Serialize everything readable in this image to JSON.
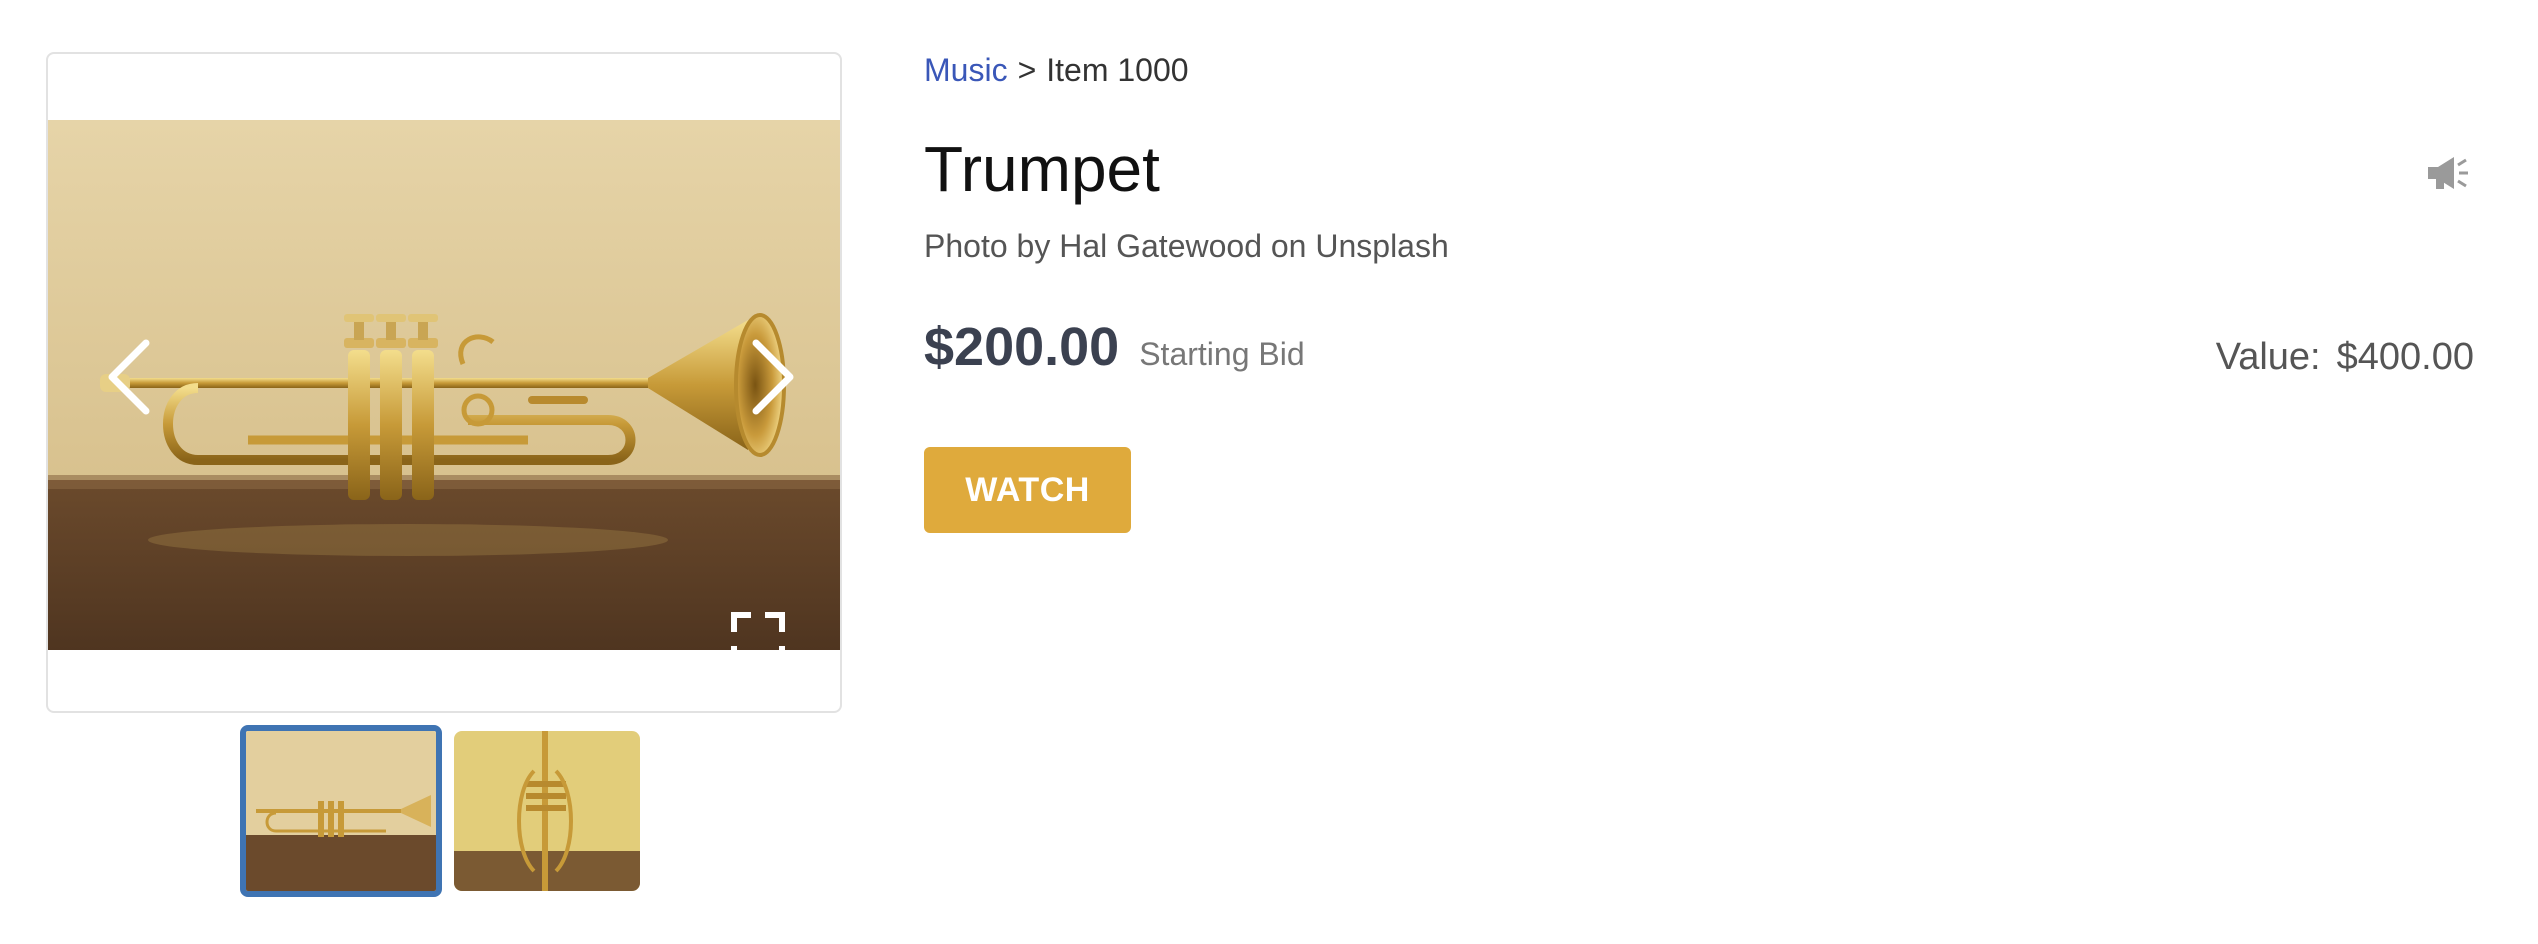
{
  "breadcrumb": {
    "category": "Music",
    "separator": ">",
    "item": "Item 1000"
  },
  "item": {
    "title": "Trumpet",
    "photo_credit": "Photo by Hal Gatewood on Unsplash",
    "price": "$200.00",
    "price_caption": "Starting Bid",
    "value_label": "Value:",
    "value_amount": "$400.00"
  },
  "actions": {
    "watch_label": "WATCH"
  },
  "gallery": {
    "thumbnail_count": 2,
    "active_thumbnail": 1
  },
  "icons": {
    "prev": "chevron-left-icon",
    "next": "chevron-right-icon",
    "fullscreen": "fullscreen-icon",
    "announce": "megaphone-icon"
  },
  "colors": {
    "link": "#3a57b8",
    "watch_button": "#dfaa3c",
    "active_thumb_border": "#3f74b3",
    "price_text": "#3b4150"
  }
}
